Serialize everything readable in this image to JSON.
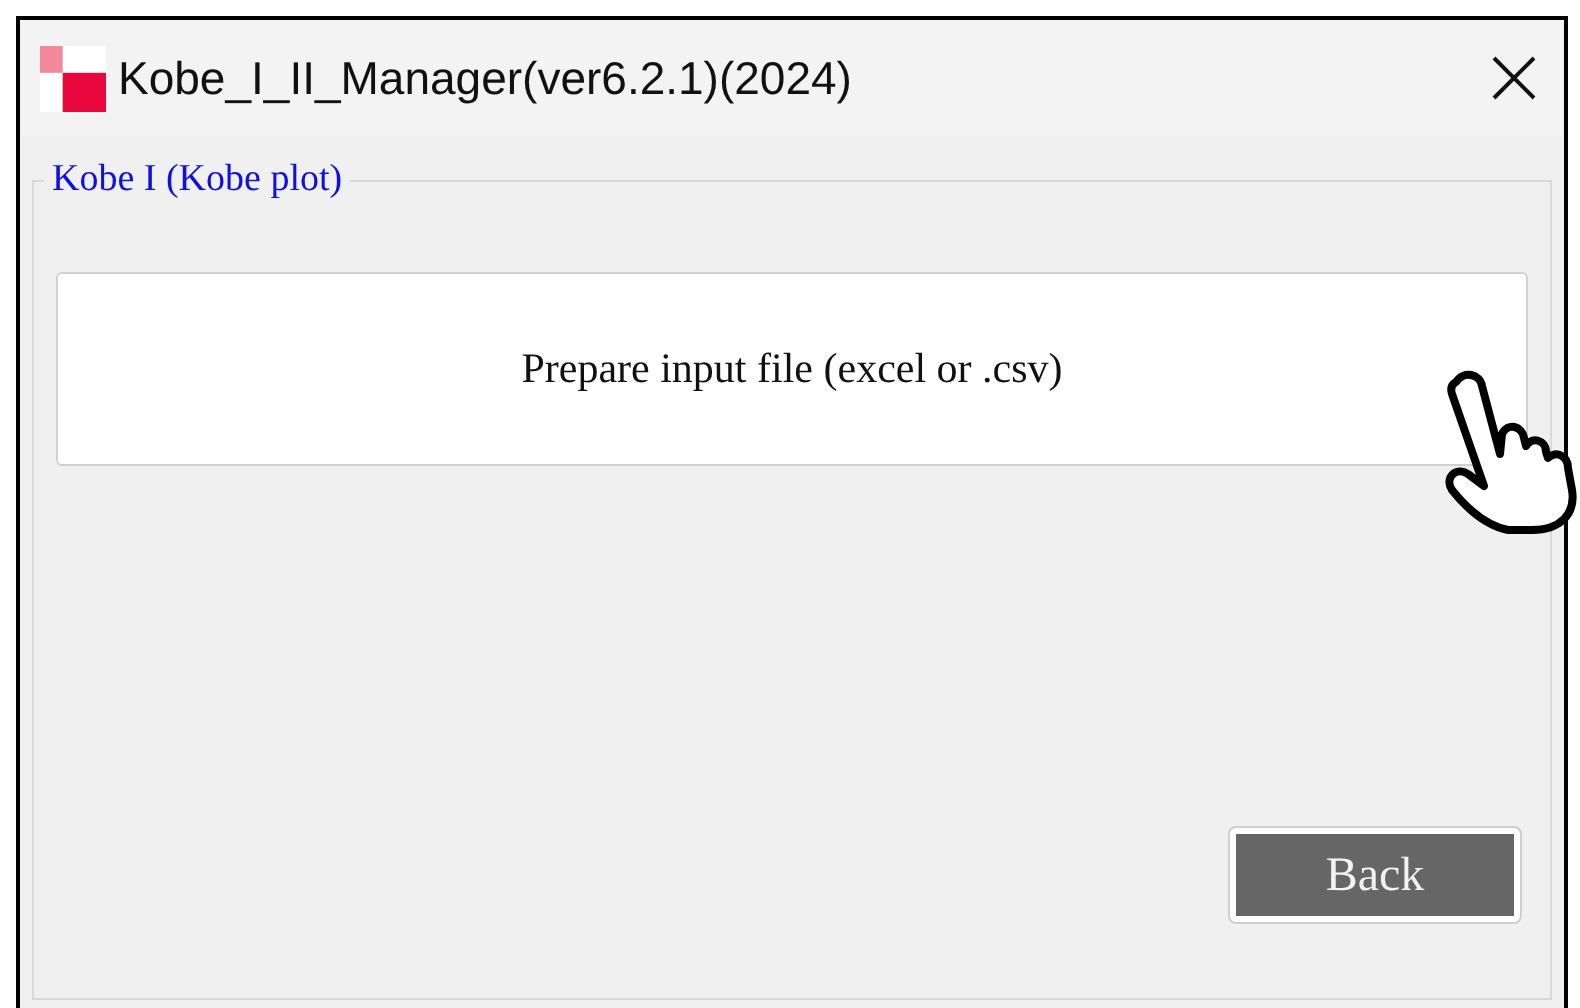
{
  "window": {
    "title": "Kobe_I_II_Manager(ver6.2.1)(2024)"
  },
  "group": {
    "legend": "Kobe I (Kobe plot)",
    "buttons": [
      {
        "kind": "wide",
        "label": "Prepare input file (excel or .csv)"
      },
      {
        "kind": "dark",
        "label": "Back"
      }
    ]
  }
}
